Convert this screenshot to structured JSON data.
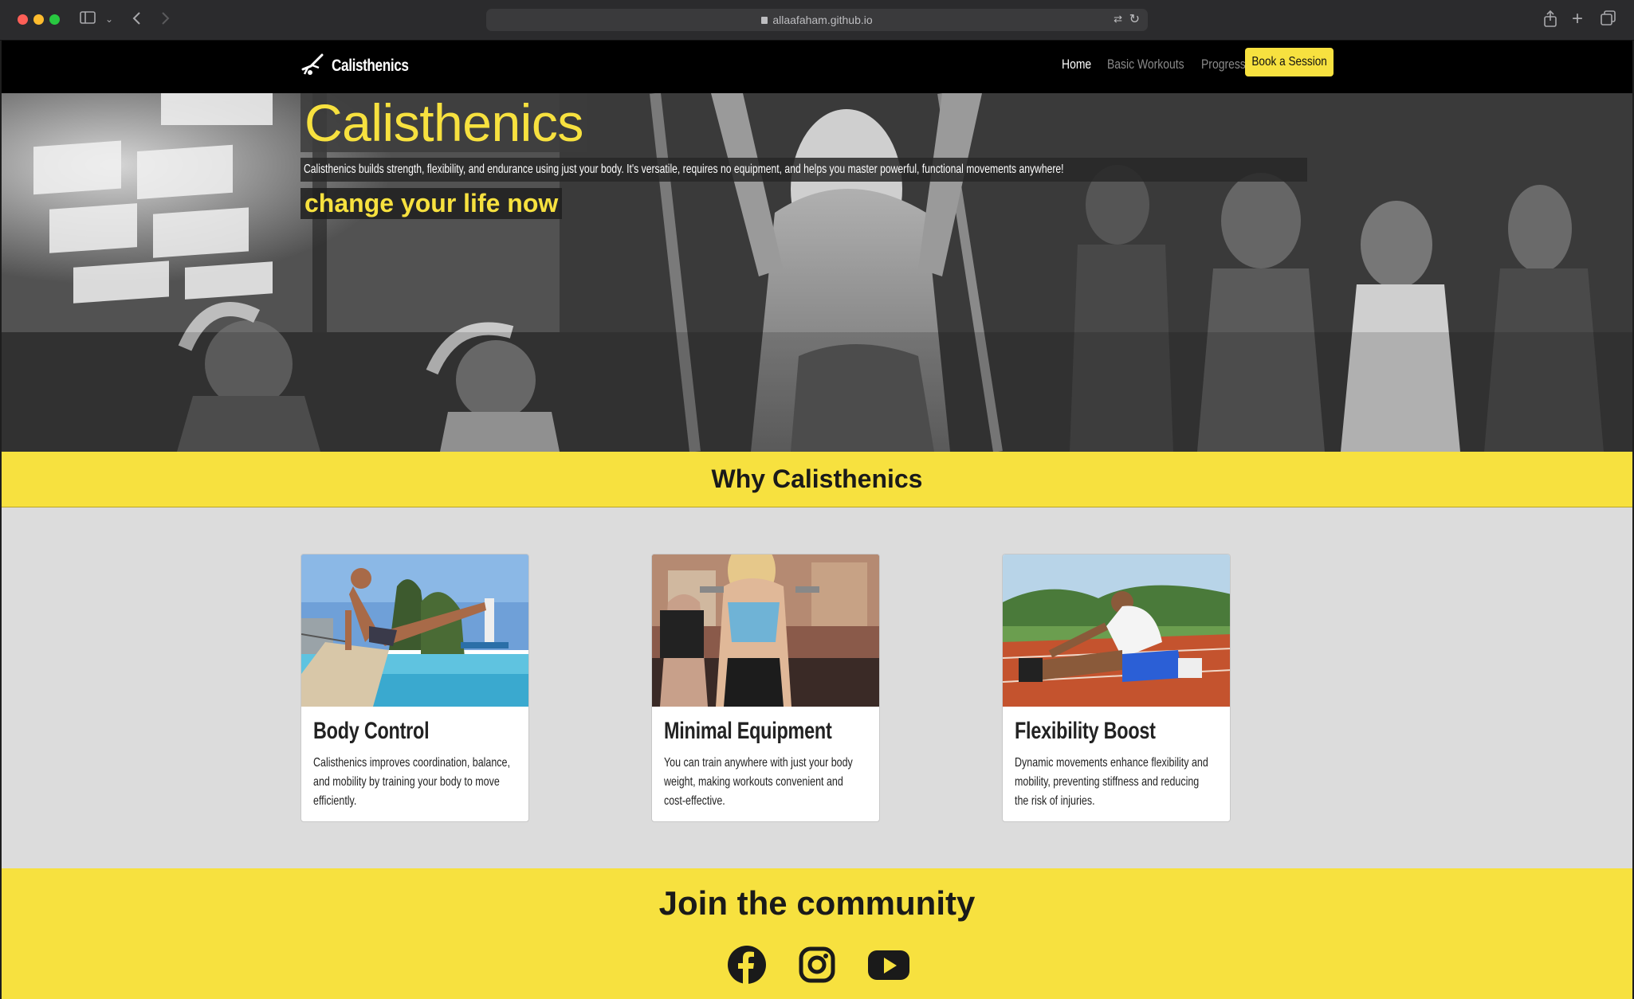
{
  "browser": {
    "url": "allaafaham.github.io"
  },
  "nav": {
    "brand": "Calisthenics",
    "links": [
      "Home",
      "Basic Workouts",
      "Progress"
    ],
    "cta": "Book a Session"
  },
  "hero": {
    "title": "Calisthenics",
    "description": "Calisthenics builds strength, flexibility, and endurance using just your body. It's versatile, requires no equipment, and helps you master powerful, functional movements anywhere!",
    "tagline": "change your life now"
  },
  "why": {
    "heading": "Why Calisthenics",
    "cards": [
      {
        "title": "Body Control",
        "text": "Calisthenics improves coordination, balance, and mobility by training your body to move efficiently."
      },
      {
        "title": "Minimal Equipment",
        "text": "You can train anywhere with just your body weight, making workouts convenient and cost-effective."
      },
      {
        "title": "Flexibility Boost",
        "text": "Dynamic movements enhance flexibility and mobility, preventing stiffness and reducing the risk of injuries."
      }
    ]
  },
  "community": {
    "heading": "Join the community",
    "socials": [
      "facebook-icon",
      "instagram-icon",
      "youtube-icon"
    ]
  },
  "colors": {
    "accent": "#f7e13f",
    "nav_bg": "#000000",
    "section_bg": "#dcdcdc"
  }
}
